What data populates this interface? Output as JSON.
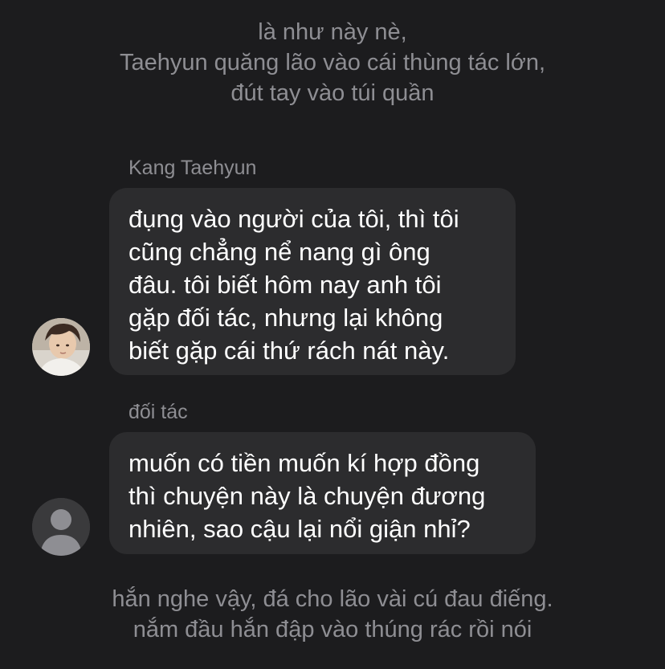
{
  "narration_top": {
    "lines": [
      "là như này nè,",
      "Taehyun quăng lão vào cái thùng tác lớn,",
      "đút tay vào túi quần"
    ]
  },
  "messages": [
    {
      "sender": "Kang Taehyun",
      "avatar_icon": "profile-photo",
      "lines": [
        "đụng vào người của tôi, thì tôi",
        "cũng chẳng nể nang gì ông",
        "đâu. tôi biết hôm nay anh tôi",
        "gặp đối tác, nhưng lại không",
        "biết gặp cái thứ rách nát này."
      ]
    },
    {
      "sender": "đối tác",
      "avatar_icon": "default-person-icon",
      "lines": [
        "muốn có tiền muốn kí hợp đồng",
        "thì chuyện này là chuyện đương",
        "nhiên, sao cậu lại nổi giận nhỉ?"
      ]
    }
  ],
  "narration_bottom": {
    "lines": [
      "hắn nghe vậy, đá cho lão vài cú đau điếng.",
      "nắm đầu hắn đập vào thúng rác rồi nói"
    ]
  },
  "colors": {
    "background": "#1c1c1e",
    "bubble": "#2c2c2e",
    "secondary_text": "#8e8e93",
    "primary_text": "#ffffff"
  }
}
